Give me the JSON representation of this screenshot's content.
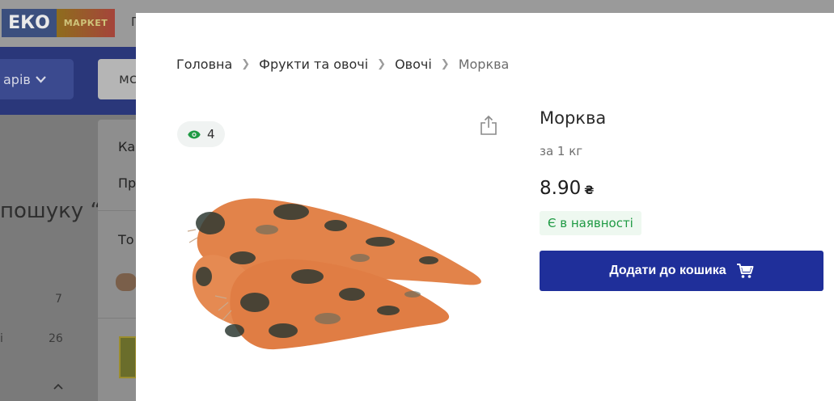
{
  "background": {
    "logo": {
      "left": "ЕКО",
      "right": "МАРКЕТ"
    },
    "nav_letter": "Г",
    "catalog_button": "арів",
    "search_value": "мс",
    "heading": "пошуку “",
    "side_counts": {
      "a": "7",
      "b": "26",
      "row_label": "і"
    },
    "dropdown": {
      "item1": "Ка",
      "item2": "Пр",
      "item3": "То"
    }
  },
  "modal": {
    "breadcrumb": [
      "Головна",
      "Фрукти та овочі",
      "Овочі",
      "Морква"
    ],
    "views_count": "4",
    "product": {
      "title": "Морква",
      "unit": "за 1 кг",
      "price": "8.90",
      "currency": "₴",
      "stock_status": "Є в наявності",
      "add_to_cart_label": "Додати до кошика"
    }
  },
  "colors": {
    "accent": "#1f2f9a",
    "stock_green": "#1f9a44",
    "views_eye": "#1f9a44"
  },
  "icons": [
    "eye-icon",
    "share-icon",
    "cart-icon",
    "chevron-down-icon",
    "chevron-right-icon",
    "chevron-up-icon"
  ]
}
